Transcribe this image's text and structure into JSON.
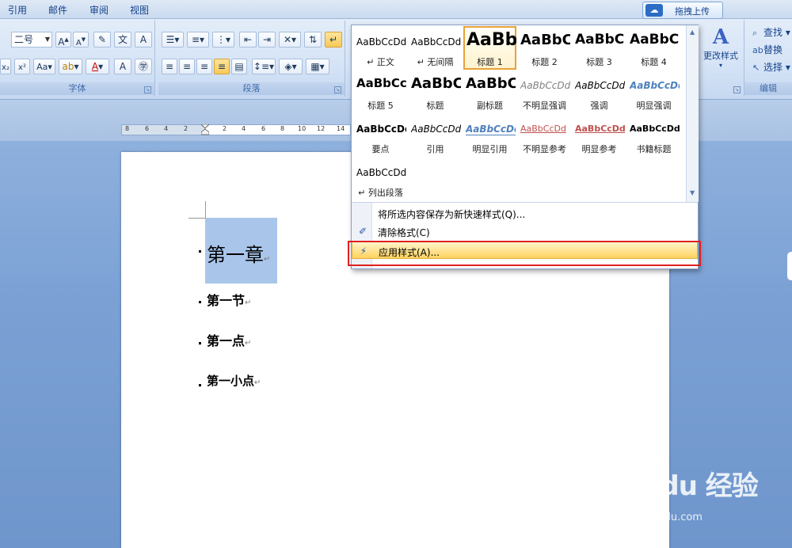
{
  "tabs": [
    "引用",
    "邮件",
    "审阅",
    "视图"
  ],
  "upload_button": "拖拽上传",
  "ribbon": {
    "font_group_label": "字体",
    "paragraph_group_label": "段落",
    "editing_group_label": "编辑",
    "font_size": "二号",
    "change_styles_label": "更改样式",
    "find_label": "查找",
    "replace_label": "替换",
    "select_label": "选择"
  },
  "ruler_ticks": [
    "8",
    "6",
    "4",
    "2",
    "2",
    "4",
    "6",
    "8",
    "10",
    "12",
    "14"
  ],
  "styles": [
    {
      "sample": "AaBbCcDd",
      "label": "↵ 正文"
    },
    {
      "sample": "AaBbCcDd",
      "label": "↵ 无间隔"
    },
    {
      "sample": "AaBb",
      "label": "标题 1"
    },
    {
      "sample": "AaBbC",
      "label": "标题 2"
    },
    {
      "sample": "AaBbC",
      "label": "标题 3"
    },
    {
      "sample": "AaBbC",
      "label": "标题 4"
    },
    {
      "sample": "AaBbCc",
      "label": "标题 5"
    },
    {
      "sample": "AaBbC",
      "label": "标题"
    },
    {
      "sample": "AaBbC",
      "label": "副标题"
    },
    {
      "sample": "AaBbCcDd",
      "label": "不明显强调"
    },
    {
      "sample": "AaBbCcDd",
      "label": "强调"
    },
    {
      "sample": "AaBbCcDd",
      "label": "明显强调"
    },
    {
      "sample": "AaBbCcDd",
      "label": "要点"
    },
    {
      "sample": "AaBbCcDd",
      "label": "引用"
    },
    {
      "sample": "AaBbCcDd",
      "label": "明显引用"
    },
    {
      "sample": "AaBbCcDd",
      "label": "不明显参考"
    },
    {
      "sample": "AaBbCcDd",
      "label": "明显参考"
    },
    {
      "sample": "AaBbCcDd",
      "label": "书籍标题"
    },
    {
      "sample": "AaBbCcDd",
      "label": "↵ 列出段落"
    }
  ],
  "menu": {
    "save_selection": "将所选内容保存为新快速样式(Q)...",
    "clear_format": "清除格式(C)",
    "apply_styles": "应用样式(A)..."
  },
  "document": {
    "h1": "第一章",
    "h2": "第一节",
    "h3": "第一点",
    "h4": "第一小点",
    "para_mark": "↵"
  },
  "watermark": {
    "logo": "Bai du 经验",
    "url": "jingyan.baidu.com"
  }
}
